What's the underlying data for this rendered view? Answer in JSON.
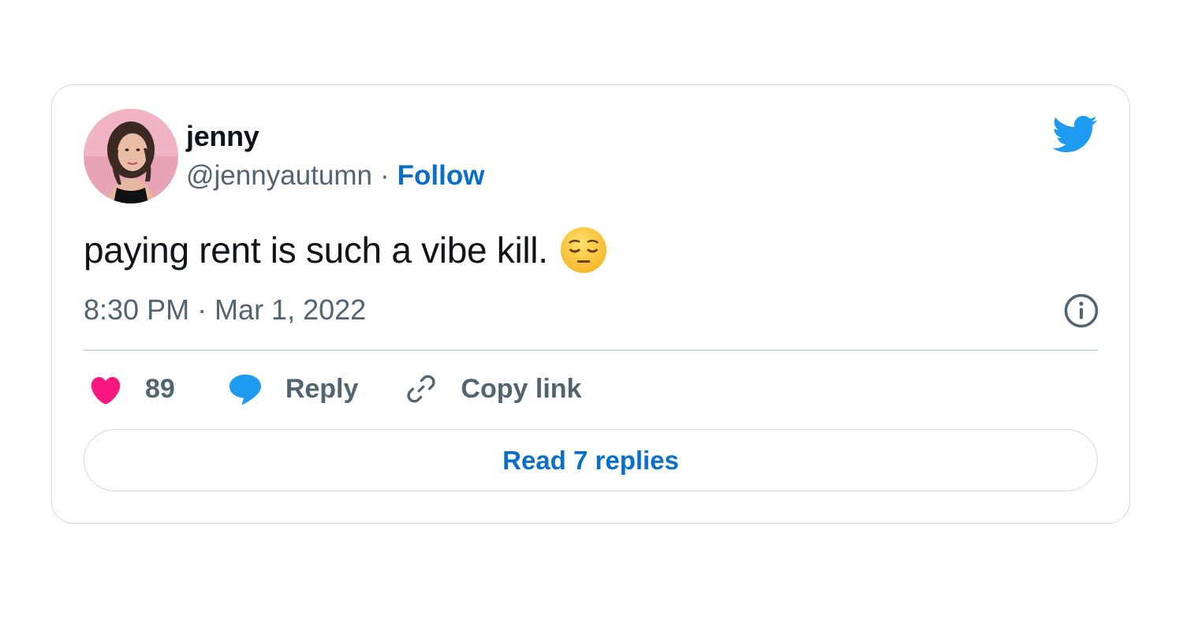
{
  "user": {
    "name": "jenny",
    "handle": "@jennyautumn",
    "separator": "·",
    "follow_label": "Follow"
  },
  "tweet": {
    "text": "paying rent is such a vibe kill.",
    "emoji": "pensive-face",
    "timestamp": "8:30 PM · Mar 1, 2022"
  },
  "actions": {
    "like_count": "89",
    "reply_label": "Reply",
    "copy_label": "Copy link"
  },
  "read_replies_label": "Read 7 replies",
  "icons": {
    "brand": "twitter-bird-icon",
    "info": "info-icon",
    "like": "heart-icon",
    "reply": "speech-bubble-icon",
    "copy": "link-icon"
  },
  "colors": {
    "brand_blue": "#1d9bf0",
    "link_blue": "#0a6fc9",
    "like_pink": "#f91880",
    "text_secondary": "#536471",
    "border": "#cfd9de"
  }
}
